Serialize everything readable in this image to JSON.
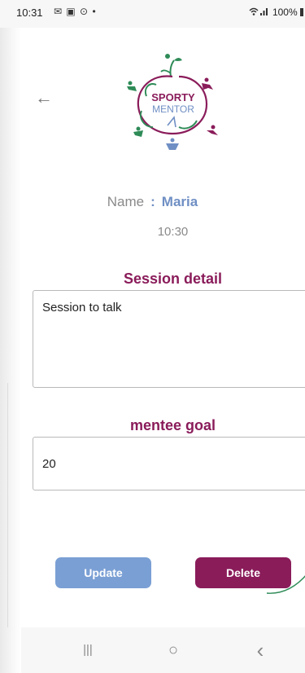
{
  "status_bar": {
    "time": "10:31",
    "left_icons": "✉ ▣ ⊙ •",
    "right_text": "100%"
  },
  "logo": {
    "line1": "SPORTY",
    "line2": "MENTOR"
  },
  "profile": {
    "name_label": "Name",
    "colon": ":",
    "name_value": "Maria",
    "time": "10:30"
  },
  "session_detail": {
    "title": "Session detail",
    "value": "Session to talk"
  },
  "mentee_goal": {
    "title": "mentee goal",
    "value": "20"
  },
  "actions": {
    "update_label": "Update",
    "delete_label": "Delete"
  },
  "colors": {
    "primary_magenta": "#8a1c5a",
    "accent_blue": "#7a9fd4",
    "name_blue": "#6f8fc4"
  },
  "nav": {
    "recents_icon": "|||",
    "home_icon": "○",
    "back_icon": "‹"
  }
}
